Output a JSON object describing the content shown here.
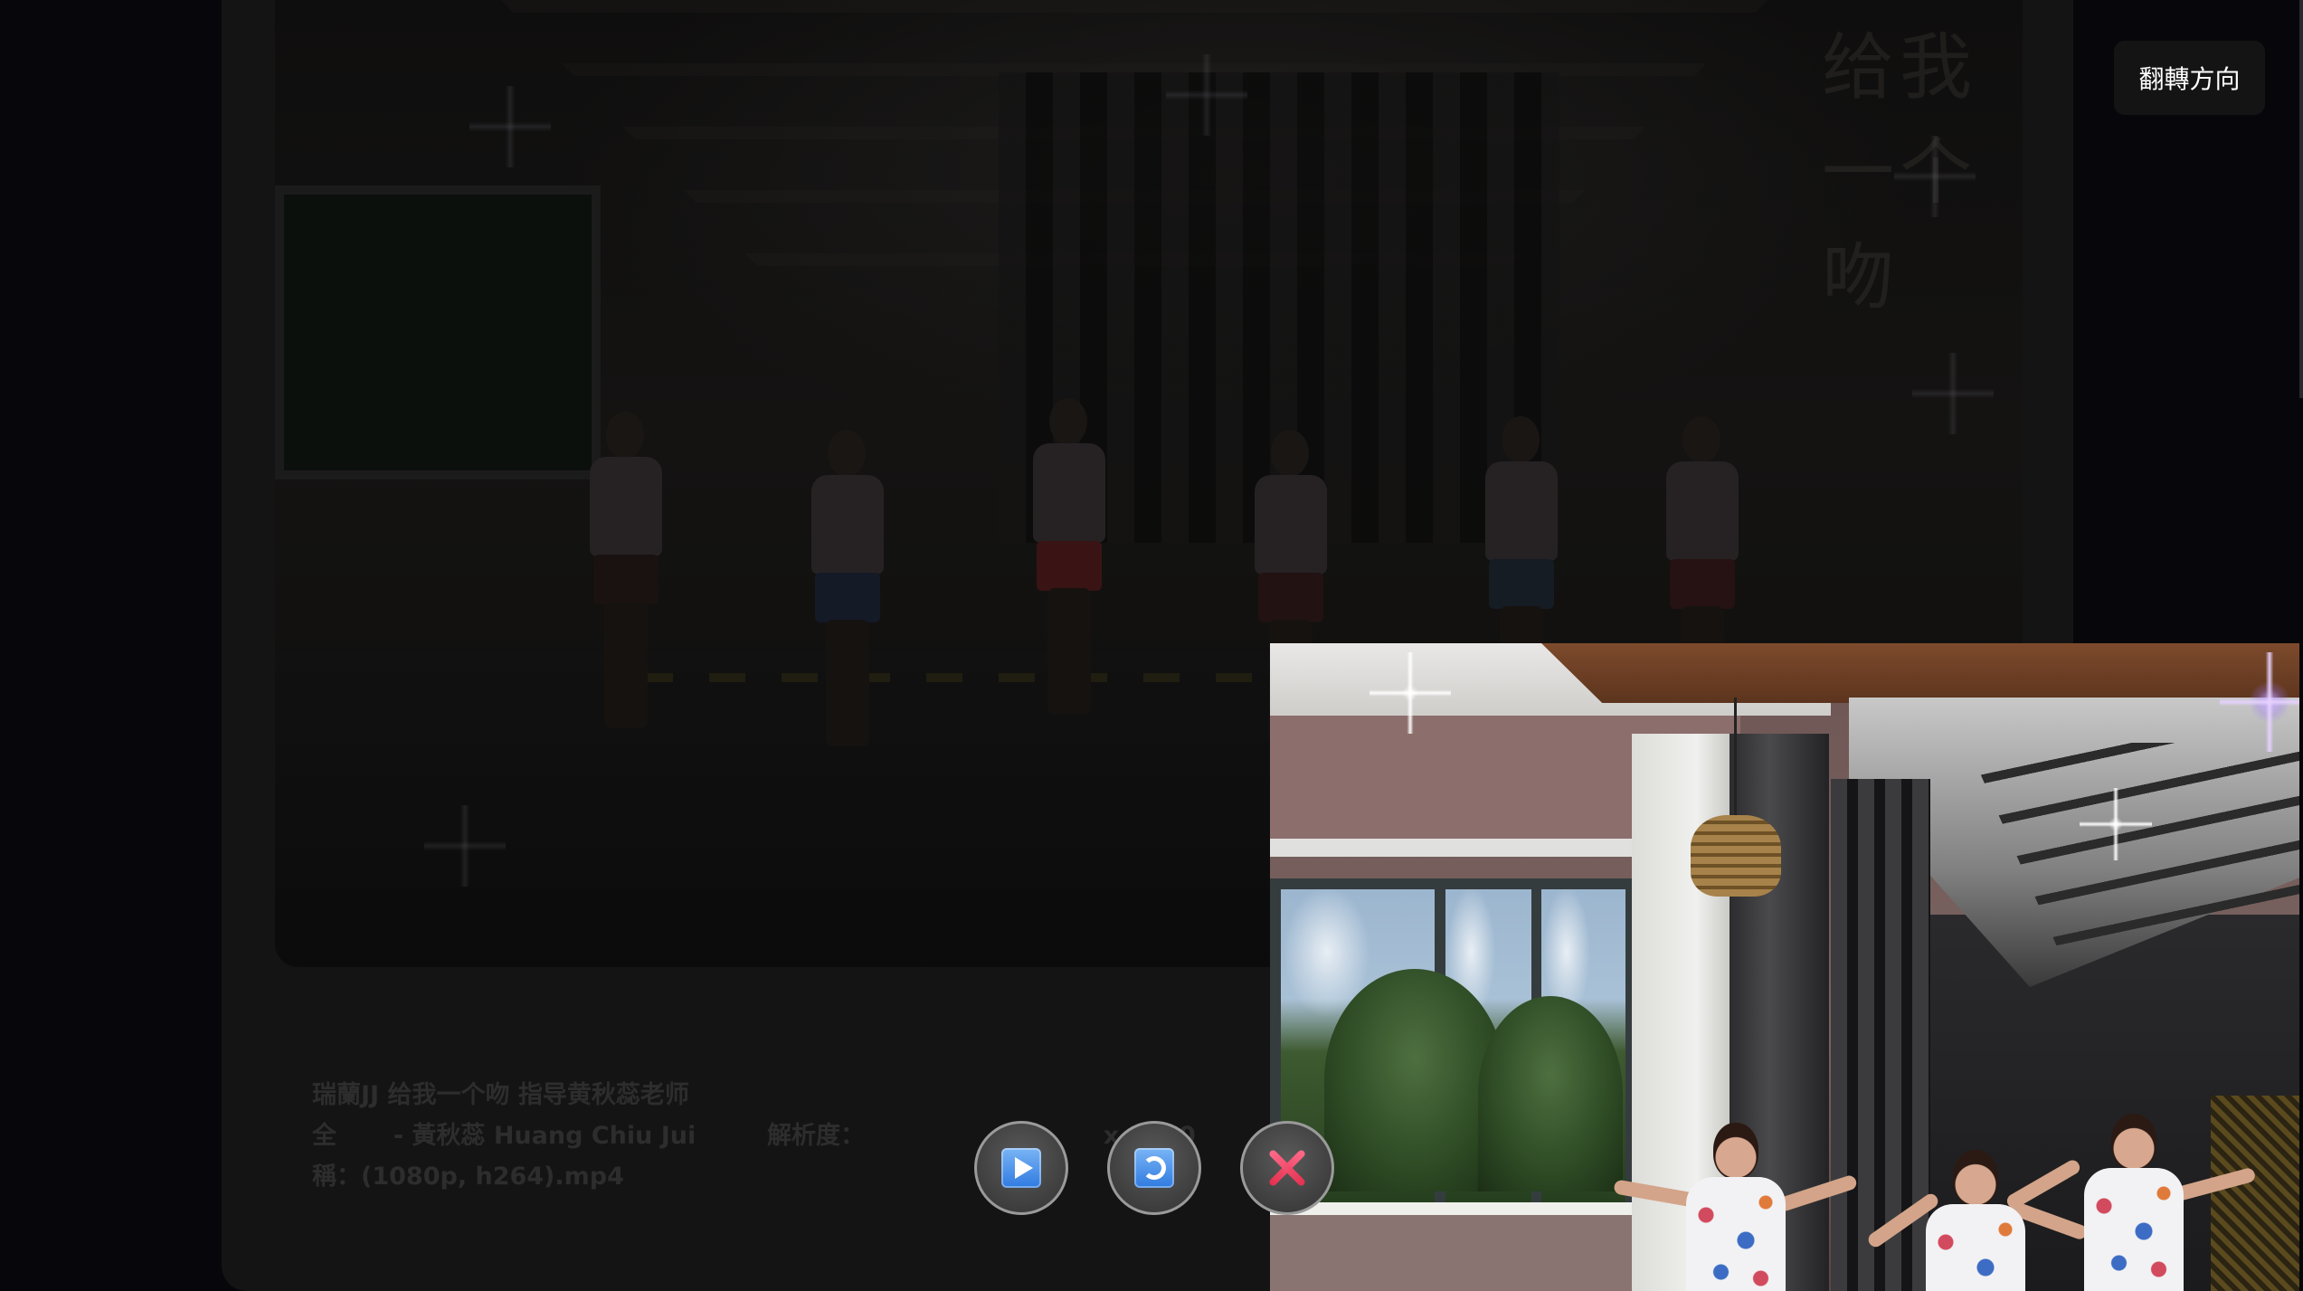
{
  "flip_button": {
    "label": "翻轉方向"
  },
  "background": {
    "video_overlay_text": "给我一个吻",
    "info": {
      "title": "瑞蘭JJ 给我一个吻 指导黄秋蕊老师",
      "author_prefix": "全",
      "author": "- 黃秋蕊 Huang Chiu Jui",
      "resolution_label": "解析度：",
      "resolution_value": "x 1080",
      "file_prefix": "稱：",
      "file": "(1080p, h264).mp4"
    }
  },
  "controls": {
    "play": "play-icon",
    "refresh": "refresh-icon",
    "close": "close-icon"
  },
  "colors": {
    "accent_blue": "#2f7be0",
    "close_red": "#e3304f",
    "button_bg": "#141414"
  }
}
